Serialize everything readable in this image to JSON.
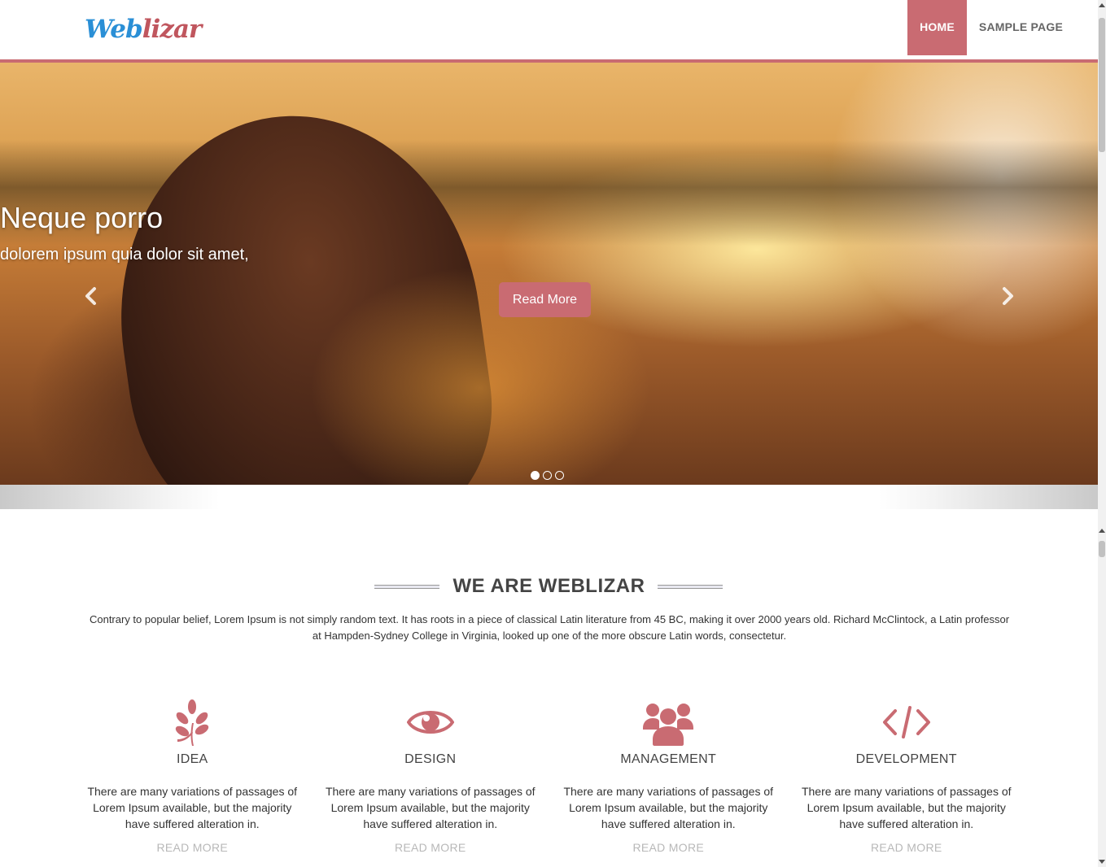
{
  "header": {
    "logo_part1": "Web",
    "logo_part2": "lizar",
    "nav": [
      {
        "label": "HOME",
        "active": true
      },
      {
        "label": "SAMPLE PAGE",
        "active": false
      }
    ]
  },
  "slider": {
    "title": "Neque porro",
    "subtitle": "dolorem ipsum quia dolor sit amet,",
    "button_label": "Read More",
    "prev_icon": "chevron-left-icon",
    "next_icon": "chevron-right-icon",
    "slides_count": 3,
    "active_slide": 1
  },
  "about": {
    "title": "WE ARE WEBLIZAR",
    "intro": "Contrary to popular belief, Lorem Ipsum is not simply random text. It has roots in a piece of classical Latin literature from 45 BC, making it over 2000 years old. Richard McClintock, a Latin professor at Hampden-Sydney College in Virginia, looked up one of the more obscure Latin words, consectetur."
  },
  "services": [
    {
      "icon": "leaf-icon",
      "title": "IDEA",
      "text": "There are many variations of passages of Lorem Ipsum available, but the majority have suffered alteration in.",
      "link": "READ MORE"
    },
    {
      "icon": "eye-icon",
      "title": "DESIGN",
      "text": "There are many variations of passages of Lorem Ipsum available, but the majority have suffered alteration in.",
      "link": "READ MORE"
    },
    {
      "icon": "users-icon",
      "title": "MANAGEMENT",
      "text": "There are many variations of passages of Lorem Ipsum available, but the majority have suffered alteration in.",
      "link": "READ MORE"
    },
    {
      "icon": "code-icon",
      "title": "DEVELOPMENT",
      "text": "There are many variations of passages of Lorem Ipsum available, but the majority have suffered alteration in.",
      "link": "READ MORE"
    }
  ],
  "colors": {
    "accent": "#c96b72",
    "logo_blue": "#2a8fd6",
    "logo_red": "#c0565e",
    "link_gray": "#b8b8b8"
  }
}
